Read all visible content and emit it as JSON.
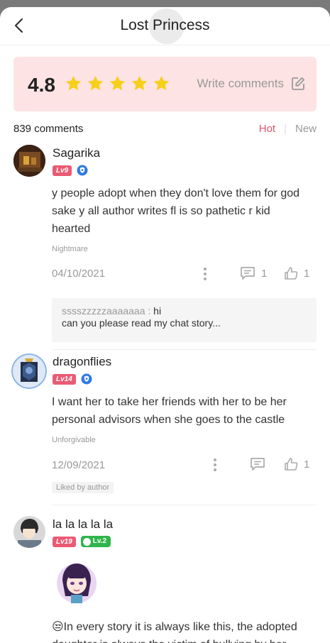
{
  "header": {
    "title": "Lost Princess"
  },
  "rating": {
    "score": "4.8",
    "stars": 5,
    "write_label": "Write comments",
    "star_color": "#f6cf1a"
  },
  "comments_bar": {
    "count": "839 comments",
    "sort_hot": "Hot",
    "sort_new": "New"
  },
  "comments": [
    {
      "user": "Sagarika",
      "level": "Lv9",
      "text": "y people adopt when they don't love them for god sake y all author writes fl is so pathetic r kid hearted",
      "tag": "Nightmare",
      "date": "04/10/2021",
      "reply_count": "1",
      "like_count": "1",
      "reply": {
        "user": "sssszzzzzaaaaaaa : ",
        "text_1": "hi",
        "text_2": "can you please read my chat story..."
      }
    },
    {
      "user": "dragonflies",
      "level": "Lv14",
      "text": "I want her to take her friends with her to be her personal advisors when she goes to the castle",
      "tag": "Unforgivable",
      "date": "12/09/2021",
      "like_count": "1",
      "liked_by_author": "Liked by author"
    },
    {
      "user": "la la la la la",
      "level": "Lv19",
      "fan_level": "Lv.2",
      "text": "😒In every story it is always like this, the adopted daughter is always the victim of bullying by her"
    }
  ],
  "colors": {
    "accent": "#ea5a73",
    "card_bg": "#fde3e3",
    "green_badge": "#2fb54b"
  }
}
